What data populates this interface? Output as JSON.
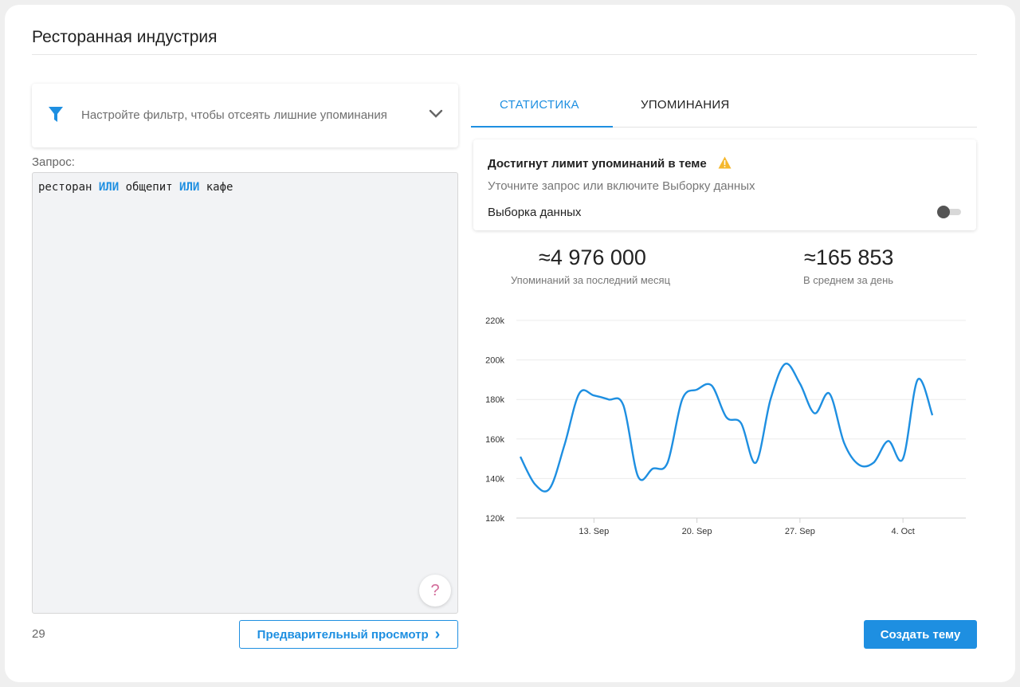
{
  "page": {
    "title": "Ресторанная индустрия"
  },
  "filter": {
    "text": "Настройте фильтр, чтобы отсеять лишние упоминания",
    "icon": "funnel-icon"
  },
  "query": {
    "label": "Запрос:",
    "tokens": [
      {
        "text": "ресторан ",
        "keyword": false
      },
      {
        "text": "ИЛИ",
        "keyword": true
      },
      {
        "text": " общепит ",
        "keyword": false
      },
      {
        "text": "ИЛИ",
        "keyword": true
      },
      {
        "text": " кафе",
        "keyword": false
      }
    ],
    "char_count": "29"
  },
  "help": {
    "glyph": "?"
  },
  "preview_button": {
    "label": "Предварительный просмотр",
    "arrow": "›"
  },
  "tabs": [
    {
      "label": "СТАТИСТИКА",
      "active": true
    },
    {
      "label": "УПОМИНАНИЯ",
      "active": false
    }
  ],
  "limit_notice": {
    "title": "Достигнут лимит упоминаний в теме",
    "subtitle": "Уточните запрос или включите Выборку данных",
    "sampling_label": "Выборка данных",
    "sampling_enabled": false
  },
  "stats": [
    {
      "value": "≈4 976 000",
      "caption": "Упоминаний за последний месяц"
    },
    {
      "value": "≈165 853",
      "caption": "В среднем за день"
    }
  ],
  "create_button": {
    "label": "Создать тему"
  },
  "colors": {
    "accent": "#1e8fe1",
    "warning": "#f5b82e",
    "help": "#d26c9a"
  },
  "chart_data": {
    "type": "line",
    "x_start": "2021-09-08",
    "x_end": "2021-10-08",
    "x_ticks": [
      {
        "date": "2021-09-13",
        "label": "13. Sep"
      },
      {
        "date": "2021-09-20",
        "label": "20. Sep"
      },
      {
        "date": "2021-09-27",
        "label": "27. Sep"
      },
      {
        "date": "2021-10-04",
        "label": "4. Oct"
      }
    ],
    "y_ticks": [
      120000,
      140000,
      160000,
      180000,
      200000,
      220000
    ],
    "y_tick_labels": [
      "120k",
      "140k",
      "160k",
      "180k",
      "200k",
      "220k"
    ],
    "ylim": [
      120000,
      220000
    ],
    "grid": true,
    "series": [
      {
        "color": "#1e8fe1",
        "points": [
          [
            "2021-09-08",
            151000
          ],
          [
            "2021-09-09",
            137000
          ],
          [
            "2021-09-10",
            135000
          ],
          [
            "2021-09-11",
            157000
          ],
          [
            "2021-09-12",
            183000
          ],
          [
            "2021-09-13",
            182000
          ],
          [
            "2021-09-14",
            180000
          ],
          [
            "2021-09-15",
            177000
          ],
          [
            "2021-09-16",
            141000
          ],
          [
            "2021-09-17",
            145000
          ],
          [
            "2021-09-18",
            148000
          ],
          [
            "2021-09-19",
            180000
          ],
          [
            "2021-09-20",
            185000
          ],
          [
            "2021-09-21",
            187000
          ],
          [
            "2021-09-22",
            171000
          ],
          [
            "2021-09-23",
            168000
          ],
          [
            "2021-09-24",
            148000
          ],
          [
            "2021-09-25",
            180000
          ],
          [
            "2021-09-26",
            198000
          ],
          [
            "2021-09-27",
            188000
          ],
          [
            "2021-09-28",
            173000
          ],
          [
            "2021-09-29",
            183000
          ],
          [
            "2021-09-30",
            158000
          ],
          [
            "2021-10-01",
            147000
          ],
          [
            "2021-10-02",
            148000
          ],
          [
            "2021-10-03",
            159000
          ],
          [
            "2021-10-04",
            150000
          ],
          [
            "2021-10-05",
            190000
          ],
          [
            "2021-10-06",
            172000
          ]
        ]
      }
    ]
  }
}
